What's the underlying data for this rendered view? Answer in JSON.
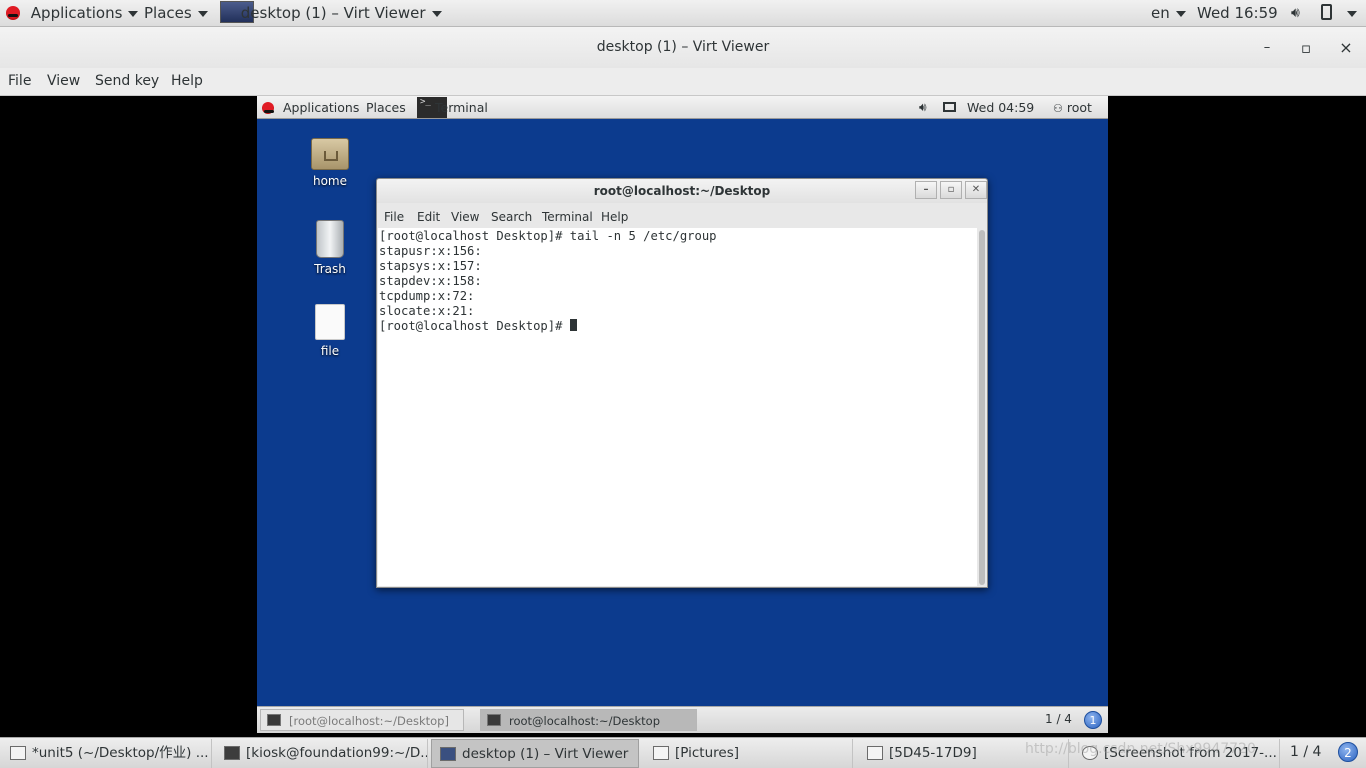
{
  "host_panel": {
    "applications": "Applications",
    "places": "Places",
    "window_title": "desktop (1) – Virt Viewer",
    "lang": "en",
    "clock": "Wed 16:59"
  },
  "viewer": {
    "title": "desktop (1) – Virt Viewer",
    "menu": [
      "File",
      "View",
      "Send key",
      "Help"
    ],
    "minimize": "–",
    "maximize": "▫",
    "close": "×"
  },
  "guest": {
    "panel": {
      "applications": "Applications",
      "places": "Places",
      "terminal": "Terminal",
      "clock": "Wed 04:59",
      "user": "root"
    },
    "desktop_icons": [
      "home",
      "Trash",
      "file"
    ],
    "terminal": {
      "title": "root@localhost:~/Desktop",
      "menu": [
        "File",
        "Edit",
        "View",
        "Search",
        "Terminal",
        "Help"
      ],
      "lines": [
        "[root@localhost Desktop]# tail -n 5 /etc/group",
        "stapusr:x:156:",
        "stapsys:x:157:",
        "stapdev:x:158:",
        "tcpdump:x:72:",
        "slocate:x:21:"
      ],
      "prompt": "[root@localhost Desktop]# "
    },
    "taskbar": {
      "items": [
        "[root@localhost:~/Desktop]",
        "root@localhost:~/Desktop"
      ],
      "workspace": "1 / 4",
      "workspace_badge": "1"
    }
  },
  "host_taskbar": {
    "items": [
      "*unit5 (~/Desktop/作业) ...",
      "[kiosk@foundation99:~/D...",
      "desktop (1) – Virt Viewer",
      "[Pictures]",
      "[5D45-17D9]",
      "[Screenshot from 2017-..."
    ],
    "workspace": "1 / 4",
    "workspace_badge": "2"
  },
  "watermark": "http://blog.csdn.net/Shx9947720"
}
